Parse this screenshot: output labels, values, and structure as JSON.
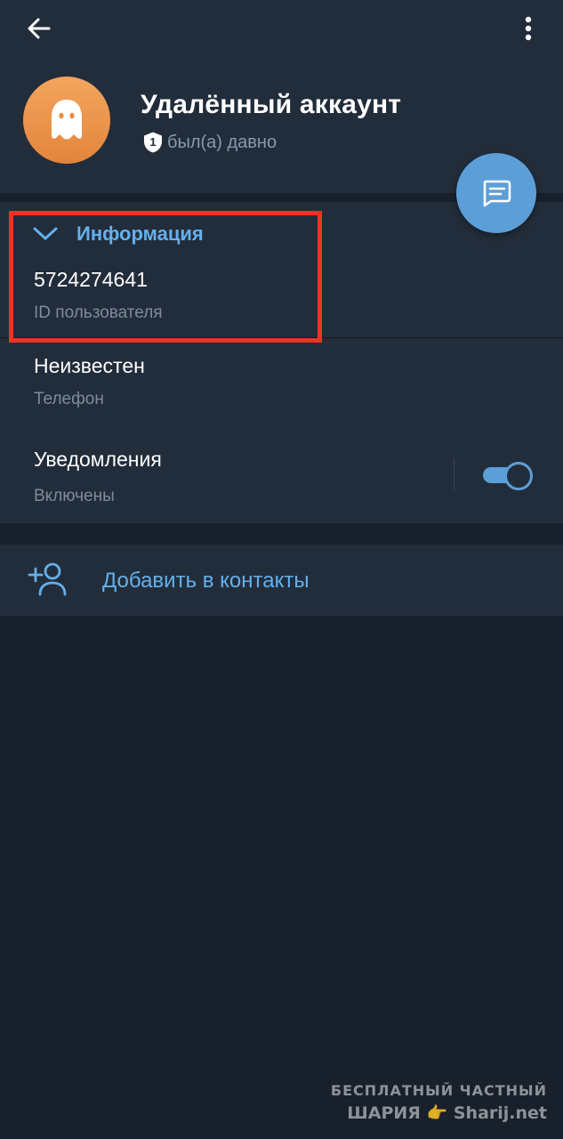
{
  "header": {
    "back_icon": "arrow-left-icon",
    "menu_icon": "more-vertical-icon",
    "name": "Удалённый аккаунт",
    "status_badge": "1",
    "status": "был(а) давно",
    "message_icon": "chat-bubble-icon"
  },
  "info": {
    "section_title": "Информация",
    "user_id": "5724274641",
    "user_id_label": "ID пользователя",
    "phone": "Неизвестен",
    "phone_label": "Телефон",
    "notifications": "Уведомления",
    "notifications_status": "Включены",
    "notifications_enabled": true
  },
  "actions": {
    "add_contact": "Добавить в контакты",
    "add_contact_icon": "add-user-icon"
  },
  "watermark": {
    "line1": "БЕСПЛАТНЫЙ ЧАСТНЫЙ",
    "line2_prefix": "ШАРИЯ",
    "line2_suffix": "Sharij.net",
    "emoji": "👉"
  },
  "colors": {
    "background": "#18202b",
    "card": "#222d3b",
    "accent": "#64b0ec",
    "fab": "#5c9fd8",
    "avatar": "#f0a050",
    "highlight": "#ee3322"
  }
}
